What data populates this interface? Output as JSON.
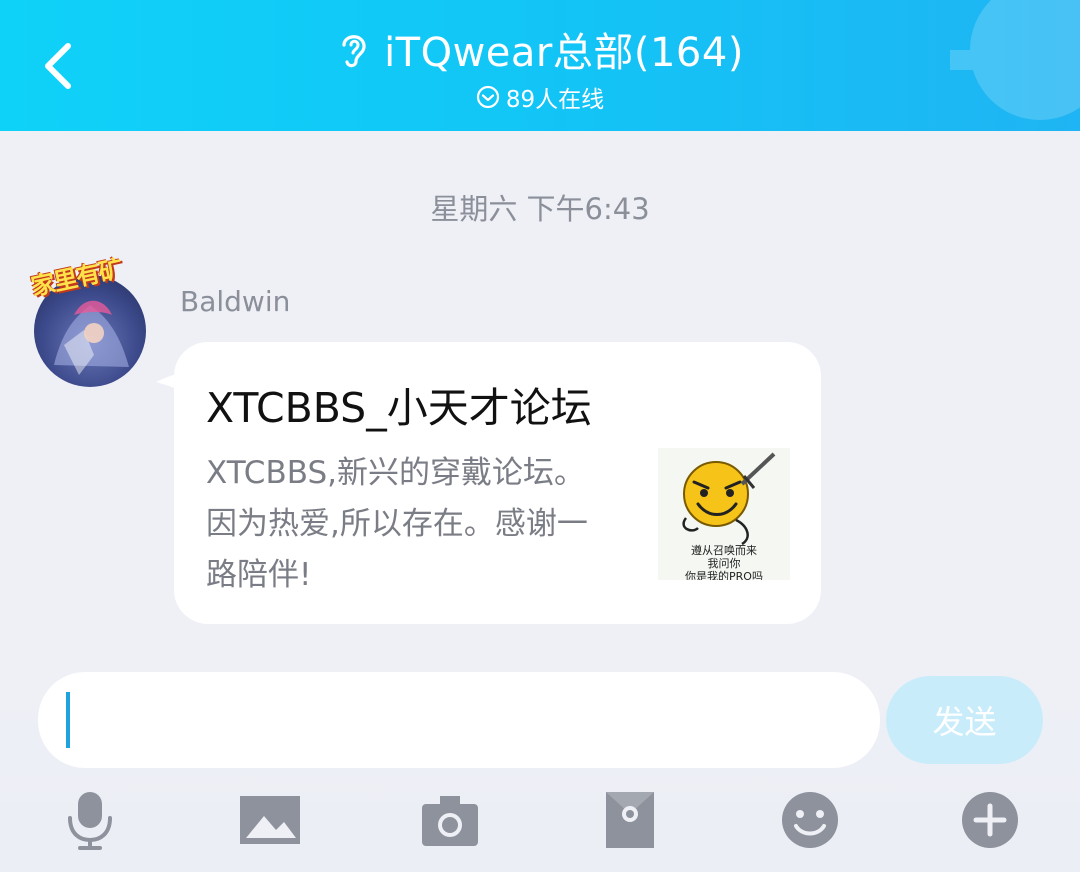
{
  "header": {
    "title": "iTQwear总部(164)",
    "subtitle": "89人在线",
    "back_icon": "chevron-left-icon",
    "ear_icon": "ear-icon",
    "online_icon": "check-circle-icon",
    "gradient_start": "#0fd2f8",
    "gradient_end": "#1fb4f3"
  },
  "chat": {
    "timestamp": "星期六 下午6:43",
    "message": {
      "sender": "Baldwin",
      "avatar_badge": "家里有矿",
      "card": {
        "title": "XTCBBS_小天才论坛",
        "description": "XTCBBS,新兴的穿戴论坛。因为热爱,所以存在。感谢一路陪伴!",
        "thumbnail_lines": [
          "遵从召唤而来",
          "我问你",
          "你是我的PRO吗"
        ]
      }
    }
  },
  "composer": {
    "input_value": "",
    "send_label": "发送",
    "send_color": "#c9ecfb"
  },
  "toolbar": {
    "items": [
      "microphone-icon",
      "image-icon",
      "camera-icon",
      "red-packet-icon",
      "emoji-icon",
      "plus-icon"
    ],
    "icon_color": "#8d929c"
  }
}
